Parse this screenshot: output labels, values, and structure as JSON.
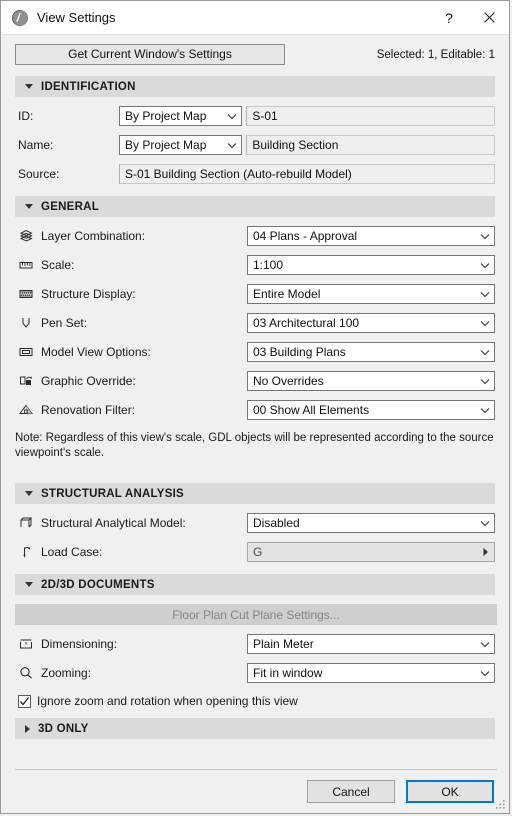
{
  "window": {
    "title": "View Settings",
    "app_icon": "archicad-icon",
    "help_label": "?",
    "close_label": "✕"
  },
  "toolbar": {
    "get_settings_label": "Get Current Window's Settings",
    "selection_info": "Selected: 1, Editable: 1"
  },
  "sections": {
    "identification": {
      "title": "IDENTIFICATION",
      "expanded": true,
      "rows": {
        "id": {
          "label": "ID:",
          "combo_value": "By Project Map",
          "field_value": "S-01"
        },
        "name": {
          "label": "Name:",
          "combo_value": "By Project Map",
          "field_value": "Building Section"
        },
        "source": {
          "label": "Source:",
          "field_value": "S-01 Building Section (Auto-rebuild Model)"
        }
      }
    },
    "general": {
      "title": "GENERAL",
      "expanded": true,
      "rows": [
        {
          "icon": "layers-icon",
          "label": "Layer Combination:",
          "value": "04 Plans - Approval"
        },
        {
          "icon": "ruler-icon",
          "label": "Scale:",
          "value": "1:100"
        },
        {
          "icon": "structure-icon",
          "label": "Structure Display:",
          "value": "Entire Model"
        },
        {
          "icon": "pen-icon",
          "label": "Pen Set:",
          "value": "03 Architectural 100"
        },
        {
          "icon": "model-view-icon",
          "label": "Model View Options:",
          "value": "03 Building Plans"
        },
        {
          "icon": "graphic-override-icon",
          "label": "Graphic Override:",
          "value": "No Overrides"
        },
        {
          "icon": "renovation-icon",
          "label": "Renovation Filter:",
          "value": "00 Show All Elements"
        }
      ],
      "note": "Note: Regardless of this view's scale, GDL objects will be represented according to the source viewpoint's scale."
    },
    "structural_analysis": {
      "title": "STRUCTURAL ANALYSIS",
      "expanded": true,
      "rows": [
        {
          "icon": "analytical-model-icon",
          "label": "Structural Analytical Model:",
          "value": "Disabled",
          "control": "dropdown",
          "disabled": false
        },
        {
          "icon": "load-case-icon",
          "label": "Load Case:",
          "value": "G",
          "control": "flyout",
          "disabled": true
        }
      ]
    },
    "documents_2d3d": {
      "title": "2D/3D DOCUMENTS",
      "expanded": true,
      "cut_plane_button": "Floor Plan Cut Plane Settings...",
      "rows": [
        {
          "icon": "dimension-icon",
          "label": "Dimensioning:",
          "value": "Plain Meter"
        },
        {
          "icon": "magnifier-icon",
          "label": "Zooming:",
          "value": "Fit in window"
        }
      ],
      "checkbox": {
        "label": "Ignore zoom and rotation when opening this view",
        "checked": true
      }
    },
    "three_d_only": {
      "title": "3D ONLY",
      "expanded": false
    }
  },
  "footer": {
    "cancel_label": "Cancel",
    "ok_label": "OK"
  },
  "colors": {
    "accent": "#0078d7",
    "section_header_bg": "#dadada",
    "dialog_bg": "#f0f0f0",
    "titlebar_bg": "#ffffff",
    "disabled_text": "#848484"
  }
}
